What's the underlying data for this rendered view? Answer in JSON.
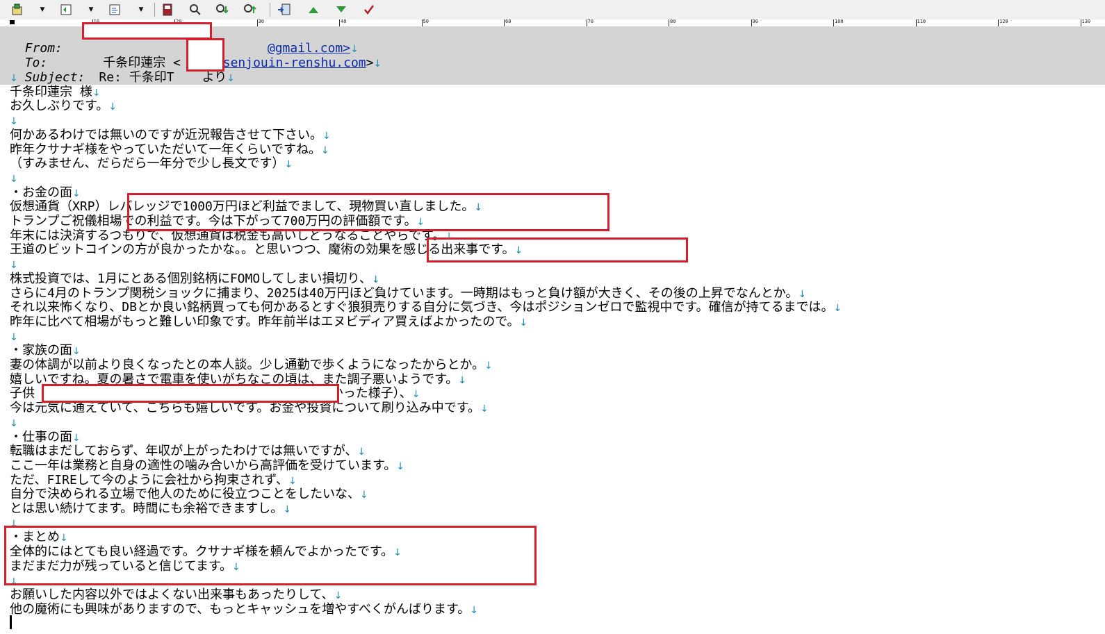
{
  "email": {
    "from_label": "From:",
    "from_value": "@gmail.com>",
    "to_label": "To:",
    "to_name": "千条印蓮宗 <",
    "to_addr": "@senjouin-renshu.com",
    "to_close": ">",
    "subject_label": "Subject:",
    "subject_prefix": "Re: 千条印T",
    "subject_suffix": "より",
    "line_end_mark": "↓"
  },
  "ruler": {
    "labels": [
      "10",
      "20",
      "30",
      "40",
      "50",
      "60",
      "70",
      "80",
      "90",
      "100",
      "110",
      "120",
      "130"
    ]
  },
  "body_lines": [
    {
      "text": ""
    },
    {
      "text": "千条印蓮宗 様"
    },
    {
      "text": "お久しぶりです。"
    },
    {
      "text": ""
    },
    {
      "text": "何かあるわけでは無いのですが近況報告させて下さい。"
    },
    {
      "text": "昨年クサナギ様をやっていただいて一年くらいですね。"
    },
    {
      "text": "（すみません、だらだら一年分で少し長文です）"
    },
    {
      "text": ""
    },
    {
      "text": "・お金の面"
    },
    {
      "text": "仮想通貨（XRP）レバレッジで1000万円ほど利益でまして、現物買い直しました。"
    },
    {
      "text": "トランプご祝儀相場での利益です。今は下がって700万円の評価額です。"
    },
    {
      "text": "年末には決済するつもりで、仮想通貨は税金も高いしどうなることやらです。"
    },
    {
      "text": "王道のビットコインの方が良かったかな。。と思いつつ、魔術の効果を感じる出来事です。"
    },
    {
      "text": ""
    },
    {
      "text": "株式投資では、1月にとある個別銘柄にFOMOしてしまい損切り、"
    },
    {
      "text": "さらに4月のトランプ関税ショックに捕まり、2025は40万円ほど負けています。一時期はもっと負け額が大きく、その後の上昇でなんとか。"
    },
    {
      "text": "それ以来怖くなり、DBとか良い銘柄買っても何かあるとすぐ狼狽売りする自分に気づき、今はポジションゼロで監視中です。確信が持てるまでは。"
    },
    {
      "text": "昨年に比べて相場がもっと難しい印象です。昨年前半はエヌビディア買えばよかったので。"
    },
    {
      "text": ""
    },
    {
      "text": "・家族の面"
    },
    {
      "text": "妻の体調が以前より良くなったとの本人談。少し通勤で歩くようになったからとか。"
    },
    {
      "text": "嬉しいですね。夏の暑さで電車を使いがちなこの頃は、また調子悪いようです。"
    },
    {
      "text": "子供                          （単に親に甘えたかった様子）、"
    },
    {
      "text": "今は元気に通えていて、こちらも嬉しいです。お金や投資について刷り込み中です。"
    },
    {
      "text": ""
    },
    {
      "text": "・仕事の面"
    },
    {
      "text": "転職はまだしておらず、年収が上がったわけでは無いですが、"
    },
    {
      "text": "ここ一年は業務と自身の適性の噛み合いから高評価を受けています。"
    },
    {
      "text": "ただ、FIREして今のように会社から拘束されず、"
    },
    {
      "text": "自分で決められる立場で他人のために役立つことをしたいな、"
    },
    {
      "text": "とは思い続けてます。時間にも余裕できますし。"
    },
    {
      "text": ""
    },
    {
      "text": "・まとめ"
    },
    {
      "text": "全体的にはとても良い経過です。クサナギ様を頼んでよかったです。"
    },
    {
      "text": "まだまだ力が残っていると信じてます。"
    },
    {
      "text": ""
    },
    {
      "text": "お願いした内容以外ではよくない出来事もあったりして、"
    },
    {
      "text": "他の魔術にも興味がありますので、もっとキャッシュを増やすべくがんばります。"
    }
  ]
}
